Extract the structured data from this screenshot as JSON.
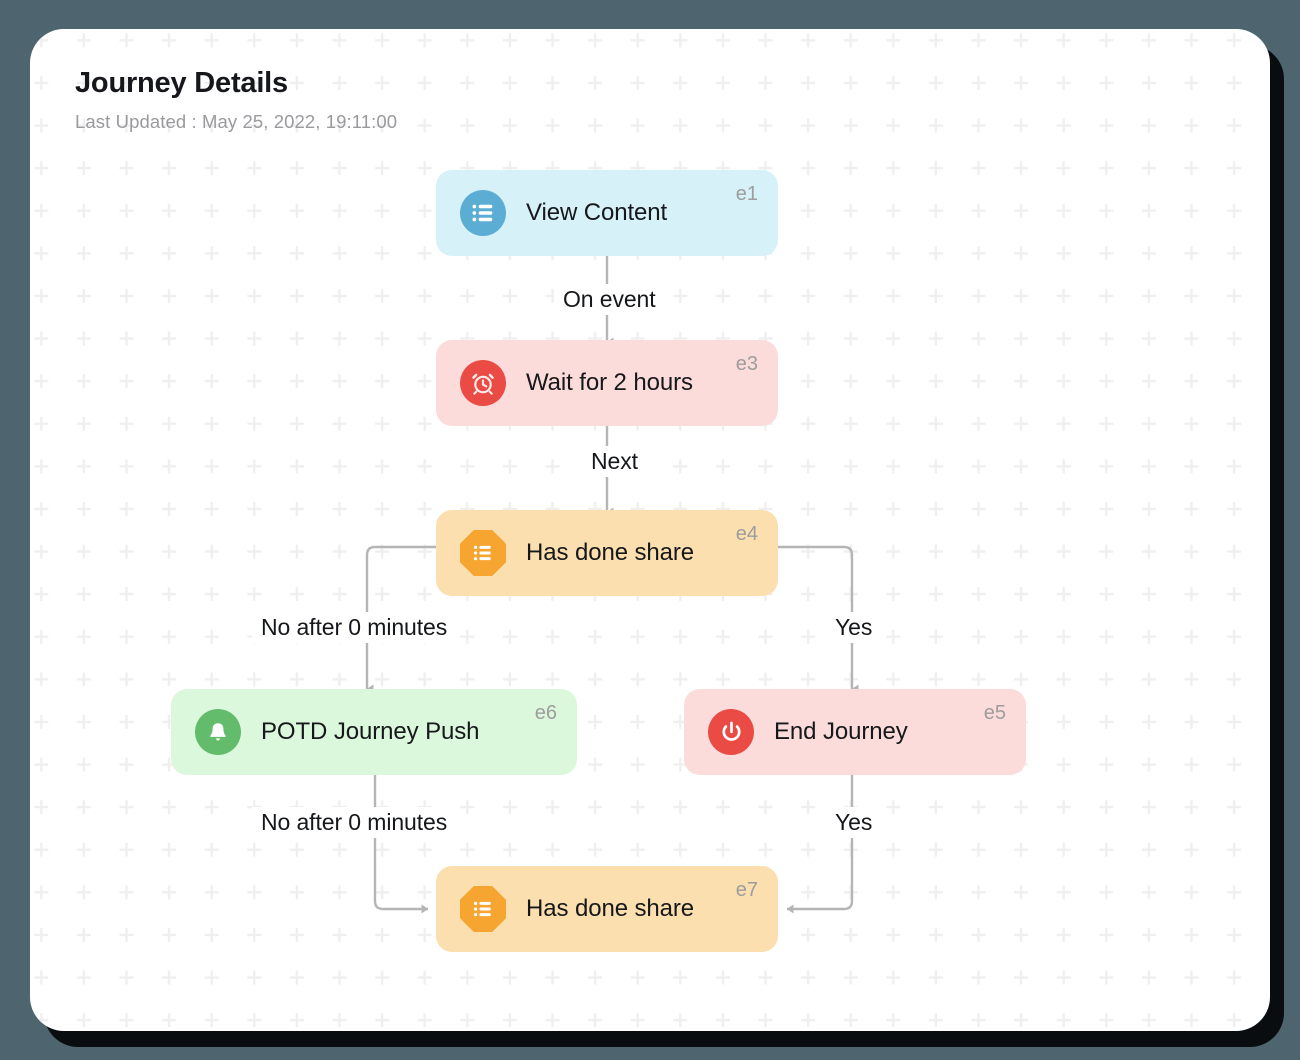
{
  "header": {
    "title": "Journey Details",
    "subtitle": "Last Updated : May 25, 2022, 19:11:00"
  },
  "theme": {
    "page_background": "#4e6570",
    "card_background": "#ffffff",
    "grid_cross_color": "#efefef",
    "edge_color": "#b5b5b5",
    "badge_color": "#9d9d9d",
    "label_color": "#15171a"
  },
  "diagram": {
    "type": "flowchart",
    "nodes": [
      {
        "id": "e1",
        "label": "View Content",
        "badge": "e1",
        "icon": "list-icon",
        "icon_shape": "circle",
        "fill": "#d6f1f7",
        "icon_fill": "#5cadd4"
      },
      {
        "id": "e3",
        "label": "Wait for 2 hours",
        "badge": "e3",
        "icon": "alarm-clock-icon",
        "icon_shape": "circle",
        "fill": "#fcdcdb",
        "icon_fill": "#ea4c45"
      },
      {
        "id": "e4",
        "label": "Has done share",
        "badge": "e4",
        "icon": "list-icon",
        "icon_shape": "octagon",
        "fill": "#fcdfae",
        "icon_fill": "#f7a531"
      },
      {
        "id": "e6",
        "label": "POTD Journey Push",
        "badge": "e6",
        "icon": "bell-icon",
        "icon_shape": "circle",
        "fill": "#dcf8dc",
        "icon_fill": "#63bc6c"
      },
      {
        "id": "e5",
        "label": "End Journey",
        "badge": "e5",
        "icon": "power-icon",
        "icon_shape": "circle",
        "fill": "#fcdcdb",
        "icon_fill": "#ea4c45"
      },
      {
        "id": "e7",
        "label": "Has done share",
        "badge": "e7",
        "icon": "list-icon",
        "icon_shape": "octagon",
        "fill": "#fcdfae",
        "icon_fill": "#f7a531"
      }
    ],
    "edges": [
      {
        "from": "e1",
        "to": "e3",
        "label": "On event"
      },
      {
        "from": "e3",
        "to": "e4",
        "label": "Next"
      },
      {
        "from": "e4",
        "to": "e6",
        "label": "No after 0 minutes"
      },
      {
        "from": "e4",
        "to": "e5",
        "label": "Yes"
      },
      {
        "from": "e6",
        "to": "e7",
        "label": "No after 0 minutes"
      },
      {
        "from": "e5",
        "to": "e7",
        "label": "Yes"
      }
    ]
  }
}
